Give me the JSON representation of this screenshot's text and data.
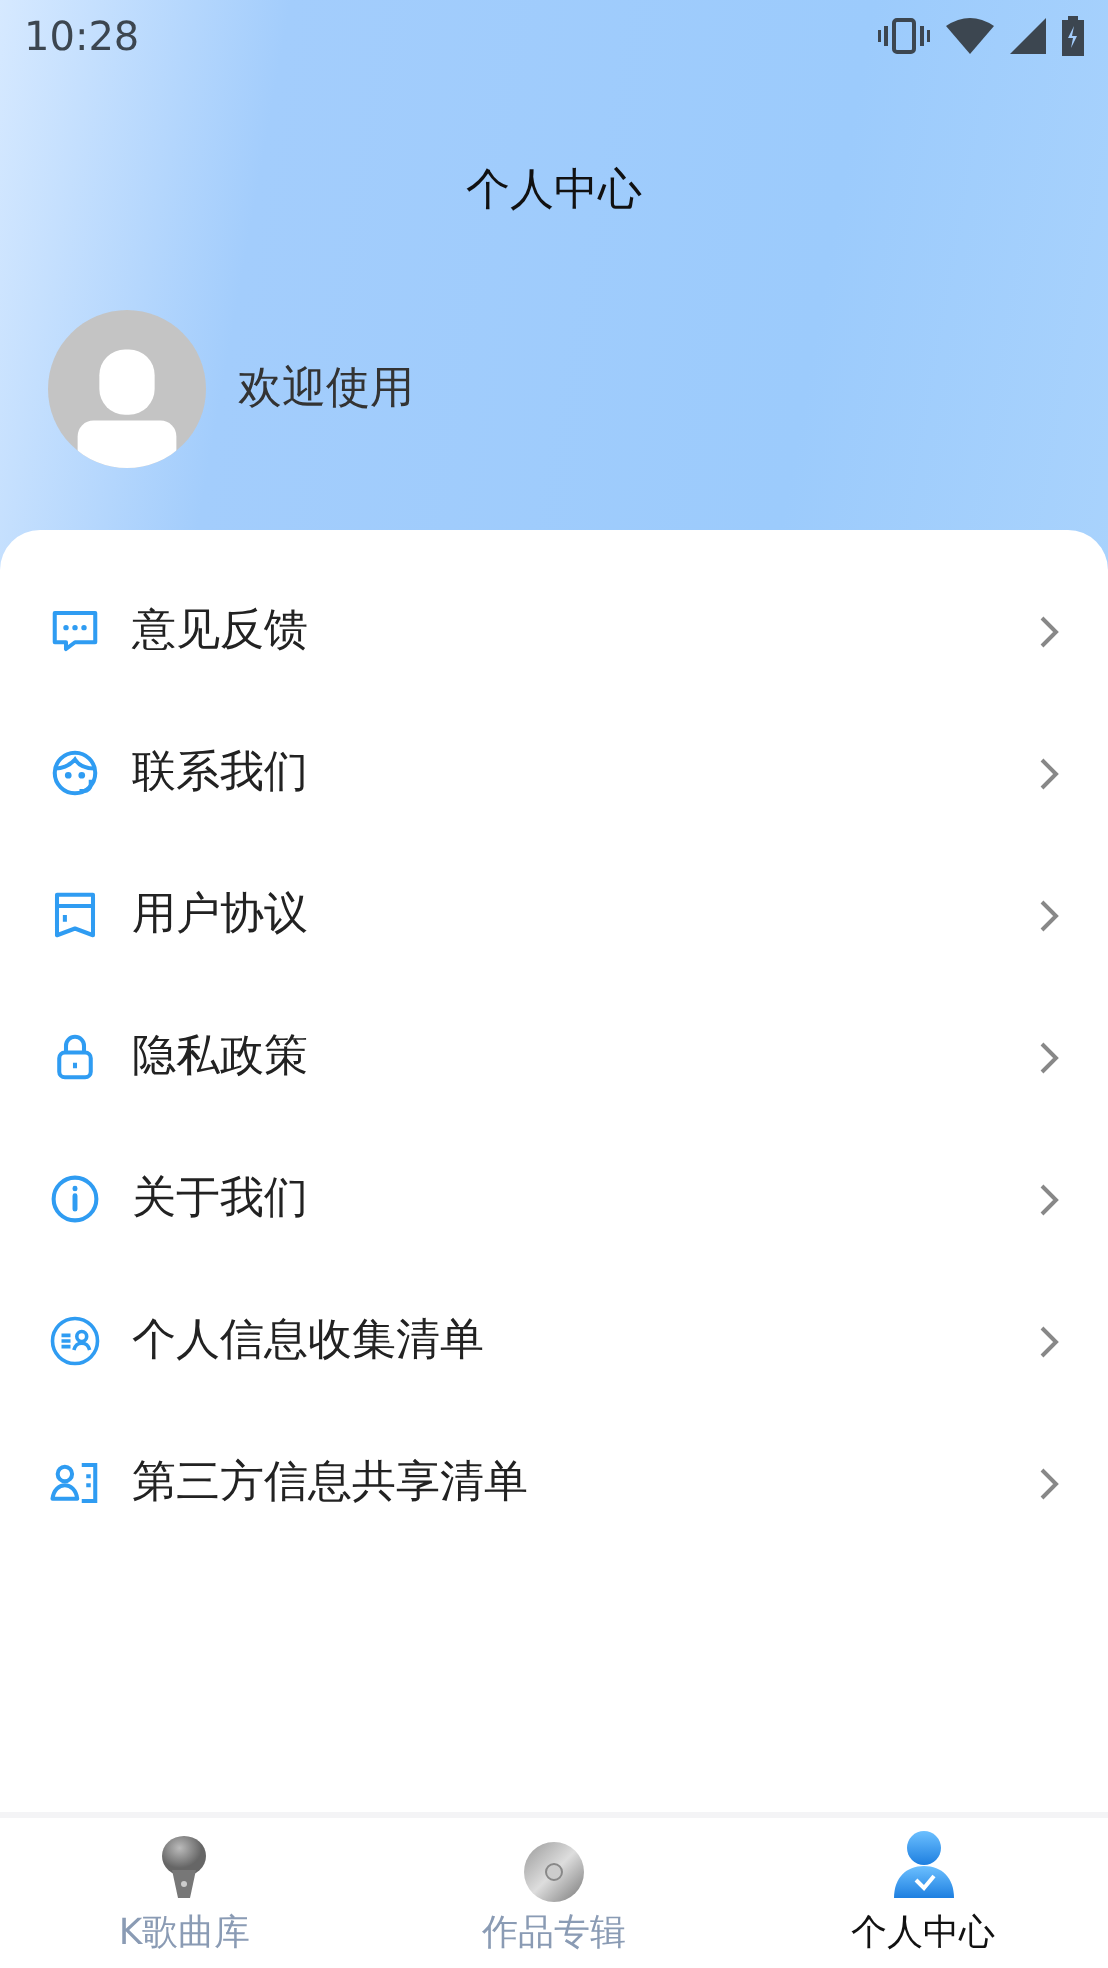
{
  "status_bar": {
    "time": "10:28"
  },
  "header": {
    "title": "个人中心",
    "welcome": "欢迎使用"
  },
  "menu": [
    {
      "label": "意见反馈"
    },
    {
      "label": "联系我们"
    },
    {
      "label": "用户协议"
    },
    {
      "label": "隐私政策"
    },
    {
      "label": "关于我们"
    },
    {
      "label": "个人信息收集清单"
    },
    {
      "label": "第三方信息共享清单"
    }
  ],
  "tabs": [
    {
      "label": "K歌曲库",
      "selected": false
    },
    {
      "label": "作品专辑",
      "selected": false
    },
    {
      "label": "个人中心",
      "selected": true
    }
  ]
}
